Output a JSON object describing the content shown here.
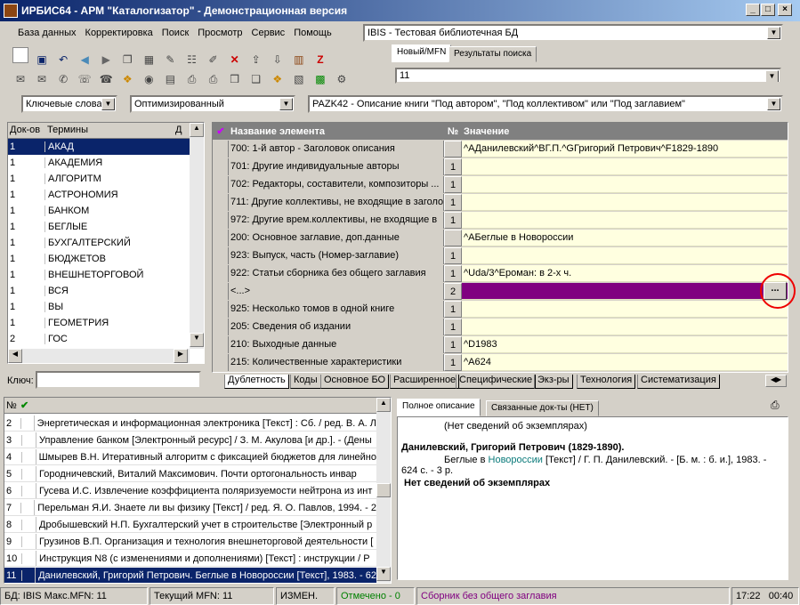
{
  "window": {
    "title": "ИРБИС64 - АРМ \"Каталогизатор\" - Демонстрационная версия",
    "min": "_",
    "max": "□",
    "close": "×"
  },
  "menu": [
    "База данных",
    "Корректировка",
    "Поиск",
    "Просмотр",
    "Сервис",
    "Помощь"
  ],
  "db_select": "IBIS - Тестовая библиотечная БД",
  "right_tabs": [
    "Новый/MFN",
    "Результаты поиска"
  ],
  "mfn_value": "11",
  "filters": {
    "key": "Ключевые слова",
    "mode": "Оптимизированный",
    "worksheet": "PAZK42 - Описание книги \"Под автором\", \"Под коллективом\" или \"Под заглавием\""
  },
  "terms": {
    "col_docs": "Док-ов",
    "col_terms": "Термины",
    "pin": "Д",
    "rows": [
      [
        "1",
        "АКАД"
      ],
      [
        "1",
        "АКАДЕМИЯ"
      ],
      [
        "1",
        "АЛГОРИТМ"
      ],
      [
        "1",
        "АСТРОНОМИЯ"
      ],
      [
        "1",
        "БАНКОМ"
      ],
      [
        "1",
        "БЕГЛЫЕ"
      ],
      [
        "1",
        "БУХГАЛТЕРСКИЙ"
      ],
      [
        "1",
        "БЮДЖЕТОВ"
      ],
      [
        "1",
        "ВНЕШНЕТОРГОВОЙ"
      ],
      [
        "1",
        "ВСЯ"
      ],
      [
        "1",
        "ВЫ"
      ],
      [
        "1",
        "ГЕОМЕТРИЯ"
      ],
      [
        "2",
        "ГОС"
      ]
    ],
    "key_label": "Ключ:"
  },
  "fields": {
    "col_name": "Название элемента",
    "col_no": "№",
    "col_value": "Значение",
    "rows": [
      [
        "700: 1-й автор - Заголовок описания",
        "",
        "^AДанилевский^BГ.П.^GГригорий Петрович^F1829-1890"
      ],
      [
        "701: Другие индивидуальные авторы",
        "1",
        ""
      ],
      [
        "702: Редакторы, составители, композиторы ...",
        "1",
        ""
      ],
      [
        "711: Другие коллективы, не входящие в заголо",
        "1",
        ""
      ],
      [
        "972: Другие врем.коллективы, не входящие в",
        "1",
        ""
      ],
      [
        "200: Основное заглавие, доп.данные",
        "",
        "^AБеглые в Новороссии"
      ],
      [
        "923: Выпуск, часть (Номер-заглавие)",
        "1",
        ""
      ],
      [
        "922: Статьи сборника без общего заглавия",
        "1",
        "^Uda/3^Ероман: в 2-х ч."
      ],
      [
        "<...>",
        "2",
        ""
      ],
      [
        "925: Несколько томов в одной книге",
        "1",
        ""
      ],
      [
        "205: Сведения об издании",
        "1",
        ""
      ],
      [
        "210: Выходные данные",
        "1",
        "^D1983"
      ],
      [
        "215: Количественные характеристики",
        "1",
        "^A624"
      ]
    ],
    "ellipsis": "..."
  },
  "bottom_tabs": [
    "Дублетность",
    "Коды",
    "Основное БО",
    "Расширенное",
    "Специфические",
    "Экз-ры",
    "Технология",
    "Систематизация"
  ],
  "results": {
    "col_no": "№",
    "rows": [
      [
        "2",
        "Энергетическая и информационная электроника [Текст] : Сб. / ред. В. А. Л"
      ],
      [
        "3",
        "Управление банком [Электронный ресурс]  / З. М. Акулова [и др.]. - (Дены"
      ],
      [
        "4",
        "Шмырев В.Н. Итеративный алгоритм с фиксацией бюджетов для линейно"
      ],
      [
        "5",
        "Городничевский, Виталий Максимович. Почти ортогональность инвар"
      ],
      [
        "6",
        "Гусева И.С. Извлечение коэффициента поляризуемости нейтрона из инт"
      ],
      [
        "7",
        "Перельман Я.И. Знаете ли вы физику [Текст] / ред. Я. О. Павлов, 1994. - 2"
      ],
      [
        "8",
        "Дробышевский Н.П. Бухгалтерский учет в строительстве [Электронный р"
      ],
      [
        "9",
        "Грузинов В.П. Организация и технология внешнеторговой деятельности ["
      ],
      [
        "10",
        "Инструкция N8   (с изменениями и дополнениями) [Текст] : инструкции / Р"
      ],
      [
        "11",
        "Данилевский, Григорий Петрович. Беглые в Новороссии [Текст], 1983. - 62"
      ]
    ]
  },
  "desc_tabs": [
    "Полное описание",
    "Связанные док-ты (НЕТ)"
  ],
  "description": {
    "line1": "(Нет сведений об экземплярах)",
    "author": "Данилевский, Григорий Петрович (1829-1890).",
    "body_pre": "Беглые в ",
    "body_link": "Новороссии",
    "body_post": " [Текст] / Г. П. Данилевский. - [Б. м. : б. и.], 1983. -",
    "body2": "624 с. - 3 р.",
    "no_copies": "Нет сведений об экземплярах"
  },
  "status": {
    "db": "БД: IBIS Макс.MFN: 11",
    "current": "Текущий MFN: 11",
    "changed": "ИЗМЕН.",
    "marked": "Отмечено - 0",
    "worksheet": "Сборник без общего заглавия",
    "time": "17:22",
    "time2": "00:40"
  },
  "colors": {
    "accent": "#0a246a",
    "selected_value": "#800080",
    "marked": "#008000",
    "value_bg": "#ffffe0"
  }
}
